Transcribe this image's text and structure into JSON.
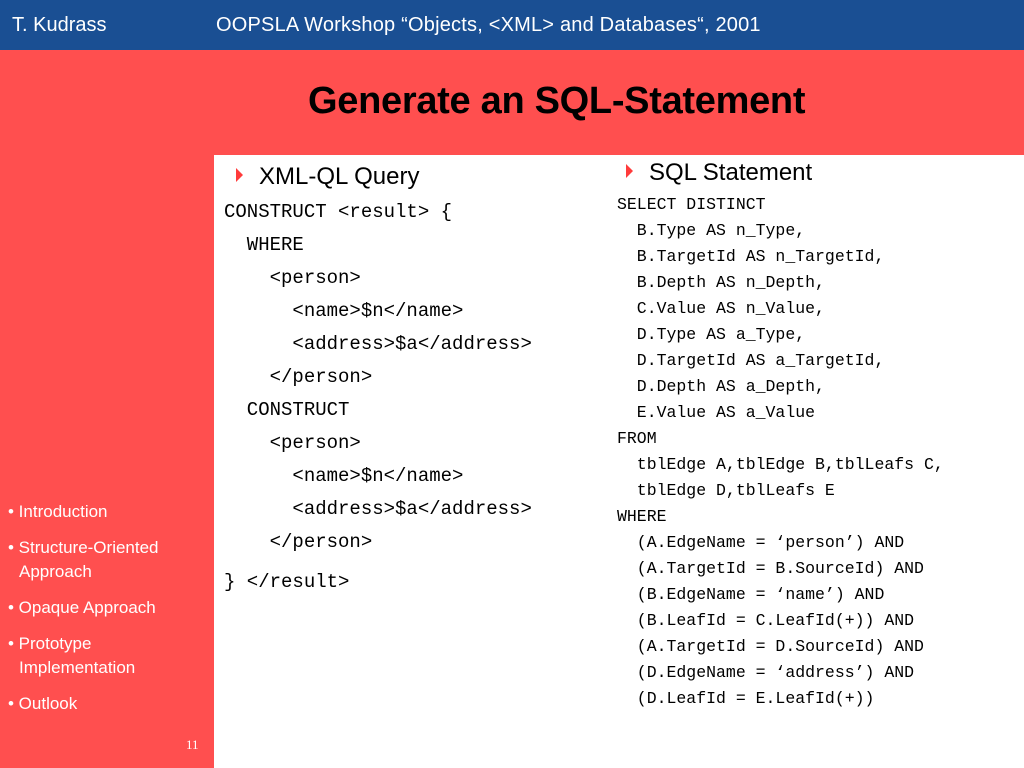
{
  "header": {
    "author": "T. Kudrass",
    "workshop": "OOPSLA Workshop “Objects, <XML> and Databases“, 2001"
  },
  "slide": {
    "title": "Generate an SQL-Statement",
    "page_number": "11"
  },
  "nav": {
    "items": [
      {
        "line1": "• Introduction",
        "line2": ""
      },
      {
        "line1": "• Structure-Oriented",
        "line2": "Approach"
      },
      {
        "line1": "• Opaque Approach",
        "line2": ""
      },
      {
        "line1": "• Prototype",
        "line2": "Implementation"
      },
      {
        "line1": "• Outlook",
        "line2": ""
      }
    ]
  },
  "xmlql": {
    "heading": "XML-QL Query",
    "lines": [
      "CONSTRUCT <result> {",
      "  WHERE",
      "    <person>",
      "      <name>$n</name>",
      "      <address>$a</address>",
      "    </person>",
      "  CONSTRUCT",
      "    <person>",
      "      <name>$n</name>",
      "      <address>$a</address>",
      "    </person>",
      "} </result>"
    ]
  },
  "sql": {
    "heading": "SQL Statement",
    "lines": [
      "SELECT DISTINCT",
      "  B.Type AS n_Type,",
      "  B.TargetId AS n_TargetId,",
      "  B.Depth AS n_Depth,",
      "  C.Value AS n_Value,",
      "  D.Type AS a_Type,",
      "  D.TargetId AS a_TargetId,",
      "  D.Depth AS a_Depth,",
      "  E.Value AS a_Value",
      "FROM",
      "  tblEdge A,tblEdge B,tblLeafs C,",
      "  tblEdge D,tblLeafs E",
      "WHERE",
      "  (A.EdgeName = ‘person’) AND",
      "  (A.TargetId = B.SourceId) AND",
      "  (B.EdgeName = ‘name’) AND",
      "  (B.LeafId = C.LeafId(+)) AND",
      "  (A.TargetId = D.SourceId) AND",
      "  (D.EdgeName = ‘address’) AND",
      "  (D.LeafId = E.LeafId(+))"
    ]
  },
  "colors": {
    "background": "#ff4f4f",
    "header_bar": "#1a4f93",
    "panel": "#ffffff",
    "bullet": "#ff3b3b"
  }
}
